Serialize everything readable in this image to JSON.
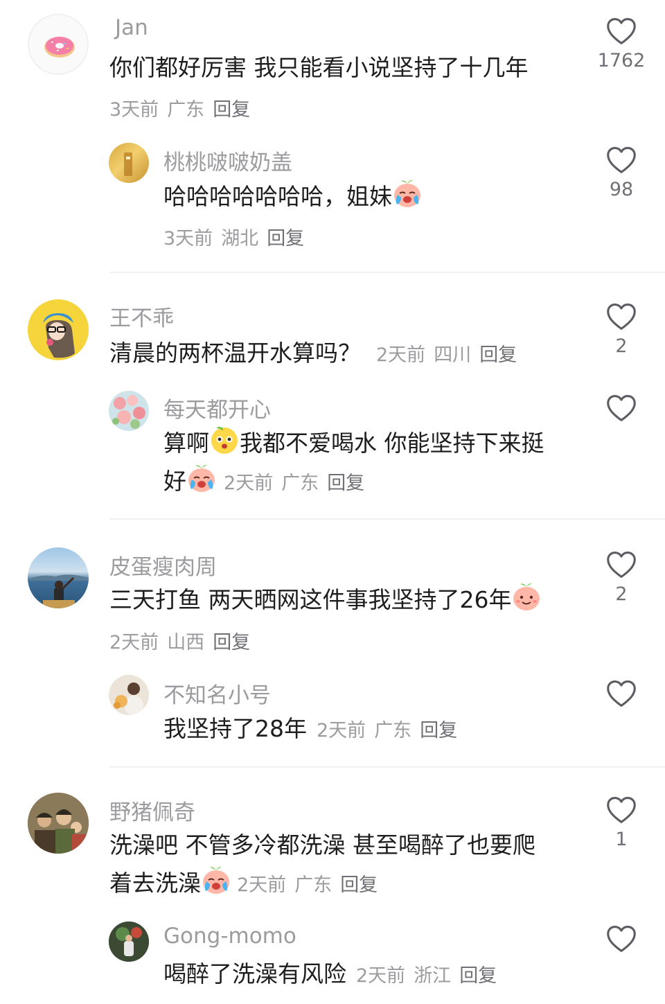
{
  "comments": [
    {
      "user": "Jan",
      "text": "你们都好厉害 我只能看小说坚持了十几年",
      "time": "3天前",
      "region": "广东",
      "reply": "回复",
      "likes": "1762",
      "replies": [
        {
          "user": "桃桃啵啵奶盖",
          "text": "哈哈哈哈哈哈哈，姐妹",
          "time": "3天前",
          "region": "湖北",
          "reply": "回复",
          "likes": "98"
        }
      ]
    },
    {
      "user": "王不乖",
      "text": "清晨的两杯温开水算吗？",
      "time": "2天前",
      "region": "四川",
      "reply": "回复",
      "likes": "2",
      "replies": [
        {
          "user": "每天都开心",
          "text_line1_a": "算啊",
          "text_line1_b": "我都不爱喝水 你能坚持下来挺",
          "text_line2": "好",
          "time": "2天前",
          "region": "广东",
          "reply": "回复",
          "likes": ""
        }
      ]
    },
    {
      "user": "皮蛋瘦肉周",
      "text": "三天打鱼 两天晒网这件事我坚持了26年",
      "time": "2天前",
      "region": "山西",
      "reply": "回复",
      "likes": "2",
      "replies": [
        {
          "user": "不知名小号",
          "text": "我坚持了28年",
          "time": "2天前",
          "region": "广东",
          "reply": "回复",
          "likes": ""
        }
      ]
    },
    {
      "user": "野猪佩奇",
      "text_line1": "洗澡吧  不管多冷都洗澡 甚至喝醉了也要爬",
      "text_line2": "着去洗澡",
      "time": "2天前",
      "region": "广东",
      "reply": "回复",
      "likes": "1",
      "replies": [
        {
          "user": "Gong-momo",
          "text": "喝醉了洗澡有风险",
          "time": "2天前",
          "region": "浙江",
          "reply": "回复",
          "likes": ""
        }
      ]
    }
  ],
  "icons": {
    "like": "heart-outline-icon",
    "emoji_cry": "crying-peach-emoji",
    "emoji_smile": "smiling-peach-emoji",
    "emoji_wow": "surprised-face-emoji"
  },
  "colors": {
    "username": "#9b9ba0",
    "text": "#1e1e1e",
    "meta": "#9b9ba0",
    "divider": "#f1f1f3"
  }
}
